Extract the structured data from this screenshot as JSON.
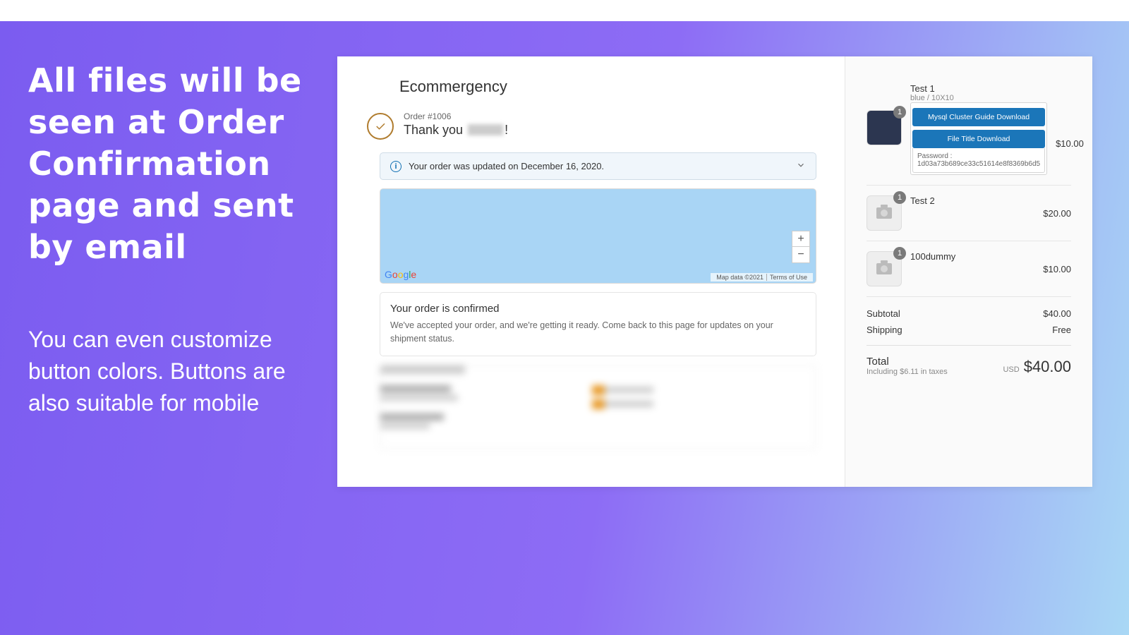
{
  "marketing": {
    "headline": "All files will be seen at Order Confirmation page and sent by email",
    "sub": "You can even customize button colors. Buttons are also suitable for mobile"
  },
  "store_name": "Ecommergency",
  "order_number_label": "Order #1006",
  "thank_you": "Thank you",
  "update_msg": "Your order was updated on December 16, 2020.",
  "map": {
    "brand": "Google",
    "data_attr": "Map data ©2021",
    "terms": "Terms of Use"
  },
  "confirm": {
    "title": "Your order is confirmed",
    "body": "We've accepted your order, and we're getting it ready. Come back to this page for updates on your shipment status."
  },
  "items": [
    {
      "title": "Test 1",
      "variant": "blue / 10X10",
      "qty": 1,
      "price": "$10.00",
      "downloads": [
        "Mysql Cluster Guide Download",
        "File Title Download"
      ],
      "password_label": "Password :",
      "password": "1d03a73b689ce33c51614e8f8369b6d5"
    },
    {
      "title": "Test 2",
      "qty": 1,
      "price": "$20.00"
    },
    {
      "title": "100dummy",
      "qty": 1,
      "price": "$10.00"
    }
  ],
  "subtotal_label": "Subtotal",
  "subtotal": "$40.00",
  "shipping_label": "Shipping",
  "shipping": "Free",
  "total_label": "Total",
  "tax_note": "Including $6.11 in taxes",
  "currency": "USD",
  "total": "$40.00"
}
